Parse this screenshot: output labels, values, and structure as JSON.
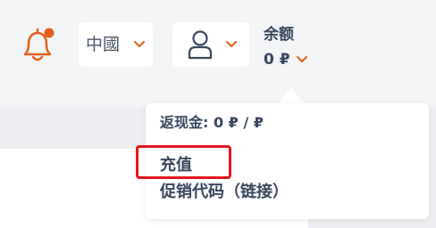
{
  "colors": {
    "accent": "#e0601b",
    "text": "#39465d",
    "highlight": "#e8141c"
  },
  "header": {
    "notification_icon": "bell-icon",
    "language": {
      "label": "中國",
      "icon": "chevron-down-icon"
    },
    "user_menu": {
      "icon": "user-icon"
    },
    "balance": {
      "title": "余额",
      "amount": "0 ₽"
    }
  },
  "dropdown": {
    "cashback": "返现金: 0 ₽ / ₽",
    "top_up": "充值",
    "promo_code": "促销代码（链接）"
  }
}
